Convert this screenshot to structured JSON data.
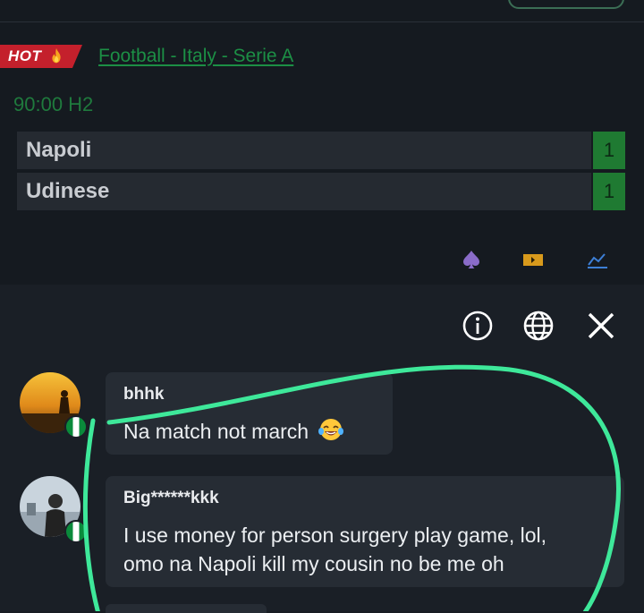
{
  "match": {
    "hot_label": "HOT",
    "league_link": "Football - Italy - Serie A",
    "time": "90:00 H2",
    "teams": [
      {
        "name": "Napoli",
        "score": "1"
      },
      {
        "name": "Udinese",
        "score": "1"
      }
    ],
    "icons": [
      "spade-icon",
      "ticket-icon",
      "stats-chart-icon"
    ]
  },
  "chat": {
    "header_icons": [
      "info-icon",
      "globe-icon",
      "close-icon"
    ],
    "messages": [
      {
        "sender": "bhhk",
        "text": "Na match not march",
        "emoji": "laughing-emoji"
      },
      {
        "sender": "Big******kkk",
        "line1": "I use money for person surgery play game, lol,",
        "line2": "omo na Napoli kill my cousin no be me oh"
      }
    ]
  },
  "colors": {
    "hot_badge": "#c4202c",
    "league_link": "#1c8f45",
    "score_bg": "#1f7a32",
    "annotation_circle": "#3ee89a"
  }
}
